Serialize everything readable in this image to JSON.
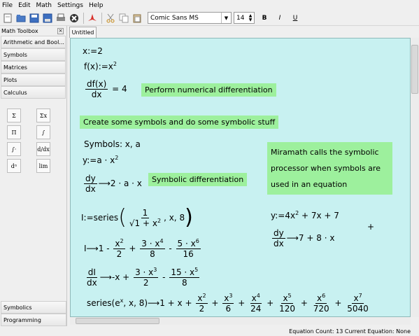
{
  "menu": [
    "File",
    "Edit",
    "Math",
    "Settings",
    "Help"
  ],
  "toolbar": {
    "font": "Comic Sans MS",
    "size": "14",
    "bold": "B",
    "italic": "I",
    "underline": "U"
  },
  "toolbox": {
    "title": "Math Toolbox",
    "categories": [
      "Arithmetic and Bool...",
      "Symbols",
      "Matrices",
      "Plots",
      "Calculus"
    ],
    "bottom_categories": [
      "Symbolics",
      "Programming"
    ]
  },
  "tab": "Untitled",
  "worksheet": {
    "eq1": "x:=2",
    "eq2": "f(x):=x",
    "eq3_num": "df(x)",
    "eq3_den": "dx",
    "eq3_res": "= 4",
    "note1": "Perform numerical differentiation",
    "note2": "Create some symbols and do some symbolic stuff",
    "symbols": "Symbols:  x, a",
    "yassign": "y:=a · x",
    "dy": "dy",
    "dx": "dx",
    "dyres": "⟶2 · a · x",
    "note3": "Symbolic differentiation",
    "note4a": "Miramath calls the symbolic",
    "note4b": "processor when symbols are",
    "note4c": "used in an equation",
    "series_lhs": "I:=series",
    "series_arg_tail": ", x, 8",
    "poly": "y:=4x",
    "poly_tail": " + 7x + 7",
    "poly_dres": "⟶7 + 8 · x",
    "expansion1": "I⟶1 -",
    "dI": "dI",
    "dI_res": "⟶-x +",
    "series_e": "series(e",
    "series_e_tail": ", x, 8)⟶1 + x +"
  },
  "status": "Equation Count: 13  Current Equation: None"
}
